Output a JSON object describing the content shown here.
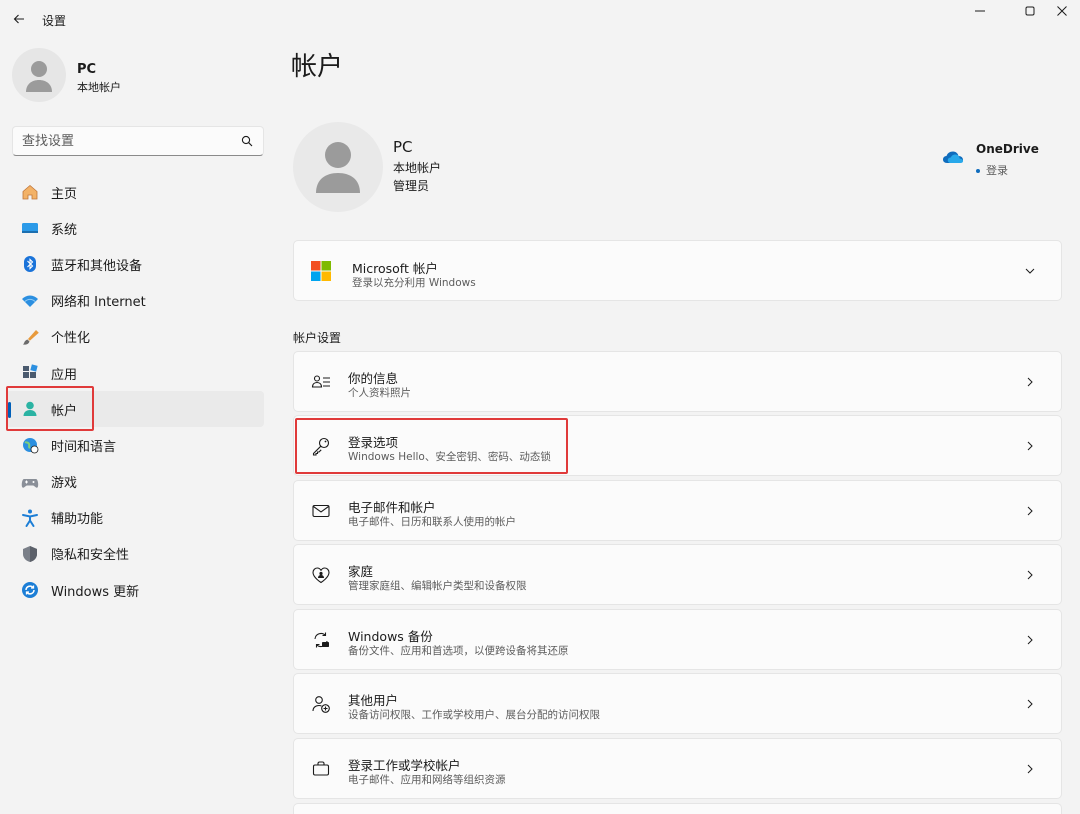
{
  "window": {
    "title": "设置"
  },
  "sidebar": {
    "user": {
      "name": "PC",
      "type": "本地帐户"
    },
    "search": {
      "placeholder": "查找设置"
    },
    "items": [
      {
        "label": "主页",
        "icon": "home-icon"
      },
      {
        "label": "系统",
        "icon": "system-icon"
      },
      {
        "label": "蓝牙和其他设备",
        "icon": "bluetooth-icon"
      },
      {
        "label": "网络和 Internet",
        "icon": "wifi-icon"
      },
      {
        "label": "个性化",
        "icon": "brush-icon"
      },
      {
        "label": "应用",
        "icon": "apps-icon"
      },
      {
        "label": "帐户",
        "icon": "account-icon",
        "selected": true
      },
      {
        "label": "时间和语言",
        "icon": "globe-clock-icon"
      },
      {
        "label": "游戏",
        "icon": "gamepad-icon"
      },
      {
        "label": "辅助功能",
        "icon": "accessibility-icon"
      },
      {
        "label": "隐私和安全性",
        "icon": "shield-icon"
      },
      {
        "label": "Windows 更新",
        "icon": "update-icon"
      }
    ]
  },
  "main": {
    "title": "帐户",
    "profile": {
      "name": "PC",
      "type": "本地帐户",
      "role": "管理员"
    },
    "onedrive": {
      "title": "OneDrive",
      "status": "登录"
    },
    "microsoft_account": {
      "title": "Microsoft 帐户",
      "subtitle": "登录以充分利用 Windows"
    },
    "section_label": "帐户设置",
    "settings": [
      {
        "title": "你的信息",
        "subtitle": "个人资料照片",
        "icon": "contact-info-icon"
      },
      {
        "title": "登录选项",
        "subtitle": "Windows Hello、安全密钥、密码、动态锁",
        "icon": "key-icon"
      },
      {
        "title": "电子邮件和帐户",
        "subtitle": "电子邮件、日历和联系人使用的帐户",
        "icon": "mail-icon"
      },
      {
        "title": "家庭",
        "subtitle": "管理家庭组、编辑帐户类型和设备权限",
        "icon": "family-heart-icon"
      },
      {
        "title": "Windows 备份",
        "subtitle": "备份文件、应用和首选项，以便跨设备将其还原",
        "icon": "backup-icon"
      },
      {
        "title": "其他用户",
        "subtitle": "设备访问权限、工作或学校用户、展台分配的访问权限",
        "icon": "add-user-icon"
      },
      {
        "title": "登录工作或学校帐户",
        "subtitle": "电子邮件、应用和网络等组织资源",
        "icon": "briefcase-icon"
      }
    ]
  },
  "colors": {
    "accent": "#005fb8",
    "highlight_box": "#e03a3a",
    "background": "#f3f3f3",
    "card": "#fbfbfb"
  }
}
